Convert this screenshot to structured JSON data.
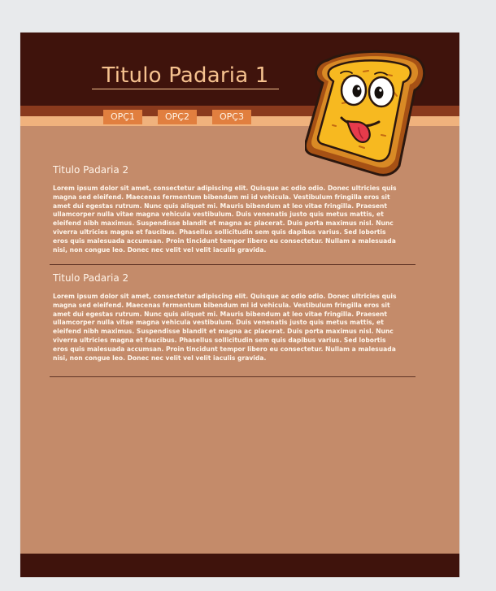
{
  "header": {
    "title": "Titulo Padaria 1"
  },
  "nav": {
    "items": [
      {
        "label": "OPÇ1"
      },
      {
        "label": "OPÇ2"
      },
      {
        "label": "OPÇ3"
      }
    ]
  },
  "sections": [
    {
      "title": "Titulo Padaria 2",
      "body": "Lorem ipsum dolor sit amet, consectetur adipiscing elit. Quisque ac odio odio. Donec ultricies quis magna sed eleifend. Maecenas fermentum bibendum mi id vehicula. Vestibulum fringilla eros sit amet dui egestas rutrum. Nunc quis aliquet mi. Mauris bibendum at leo vitae fringilla. Praesent ullamcorper nulla vitae magna vehicula vestibulum. Duis venenatis justo quis metus mattis, et eleifend nibh maximus. Suspendisse blandit et magna ac placerat. Duis porta maximus nisl. Nunc viverra ultricies magna et faucibus. Phasellus sollicitudin sem quis dapibus varius. Sed lobortis eros quis malesuada accumsan. Proin tincidunt tempor libero eu consectetur. Nullam a malesuada nisi, non congue leo. Donec nec velit vel velit iaculis gravida."
    },
    {
      "title": "Titulo Padaria 2",
      "body": "Lorem ipsum dolor sit amet, consectetur adipiscing elit. Quisque ac odio odio. Donec ultricies quis magna sed eleifend. Maecenas fermentum bibendum mi id vehicula. Vestibulum fringilla eros sit amet dui egestas rutrum. Nunc quis aliquet mi. Mauris bibendum at leo vitae fringilla. Praesent ullamcorper nulla vitae magna vehicula vestibulum. Duis venenatis justo quis metus mattis, et eleifend nibh maximus. Suspendisse blandit et magna ac placerat. Duis porta maximus nisl. Nunc viverra ultricies magna et faucibus. Phasellus sollicitudin sem quis dapibus varius. Sed lobortis eros quis malesuada accumsan. Proin tincidunt tempor libero eu consectetur. Nullam a malesuada nisi, non congue leo. Donec nec velit vel velit iaculis gravida."
    }
  ],
  "illustration": {
    "icon": "smiling-toast-icon"
  },
  "colors": {
    "header_bg": "#3f130c",
    "page_bg": "#c48b6a",
    "nav_band": "#8a3a1d",
    "nav_light": "#f0b27d",
    "nav_button": "#e17f3f",
    "title_text": "#f6c28f",
    "outer_bg": "#e8eaec"
  }
}
